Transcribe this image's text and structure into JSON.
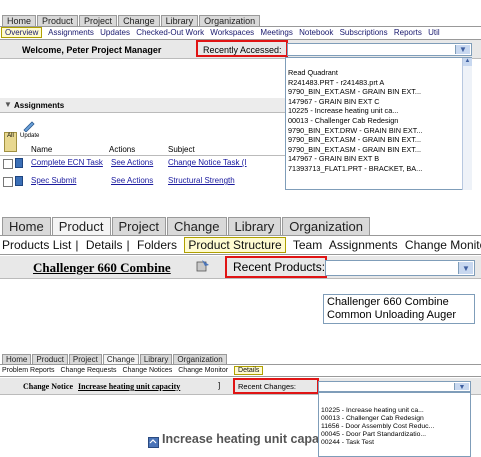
{
  "p1": {
    "tabs": [
      "Home",
      "Product",
      "Project",
      "Change",
      "Library",
      "Organization"
    ],
    "subnav": [
      "Overview",
      "Assignments",
      "Updates",
      "Checked-Out Work",
      "Workspaces",
      "Meetings",
      "Notebook",
      "Subscriptions",
      "Reports",
      "Util"
    ],
    "welcome": "Welcome, Peter Project Manager",
    "recent_label": "Recently Accessed:",
    "recent_items": [
      "Read Quadrant",
      "R241483.PRT - r241483.prt A",
      "9790_BIN_EXT.ASM - GRAIN BIN EXT...",
      "147967 - GRAIN BIN EXT C",
      "10225 - Increase heating unit ca...",
      "00013 - Challenger Cab Redesign",
      "9790_BIN_EXT.DRW - GRAIN BIN EXT...",
      "9790_BIN_EXT.ASM - GRAIN BIN EXT...",
      "9790_BIN_EXT.ASM - GRAIN BIN EXT...",
      "147967 - GRAIN BIN EXT B",
      "71393713_FLAT1.PRT - BRACKET, BA..."
    ],
    "assignments_title": "Assignments",
    "all_label": "All",
    "update_label": "Update",
    "columns": [
      "Name",
      "Actions",
      "Subject"
    ],
    "rows": [
      {
        "name": "Complete ECN Task",
        "action": "See Actions",
        "subject": "Change Notice Task (I"
      },
      {
        "name": "Spec Submit",
        "action": "See Actions",
        "subject": "Structural Strength"
      }
    ]
  },
  "p2": {
    "tabs": [
      "Home",
      "Product",
      "Project",
      "Change",
      "Library",
      "Organization"
    ],
    "subnav": [
      "Products List",
      "Details",
      "Folders",
      "Product Structure",
      "Team",
      "Assignments",
      "Change Monitor"
    ],
    "product_title": "Challenger 660 Combine",
    "recent_label": "Recent Products:",
    "recent_items": [
      "Challenger 660 Combine",
      "Common Unloading Auger"
    ]
  },
  "p3": {
    "tabs": [
      "Home",
      "Product",
      "Project",
      "Change",
      "Library",
      "Organization"
    ],
    "subnav": [
      "Problem Reports",
      "Change Requests",
      "Change Notices",
      "Change Monitor",
      "Details"
    ],
    "cn_label": "Change Notice",
    "cn_title": "Increase heating unit capacity",
    "recent_label": "Recent Changes:",
    "recent_items": [
      "10225 - Increase heating unit ca...",
      "00013 - Challenger Cab Redesign",
      "11656 - Door Assembly Cost Reduc...",
      "00045 - Door Part Standardizatio...",
      "00244 - Task Test"
    ],
    "big_title": "Increase heating unit capaci"
  },
  "colors": {
    "highlight_border": "#e01414",
    "link": "#1a1a9e"
  }
}
